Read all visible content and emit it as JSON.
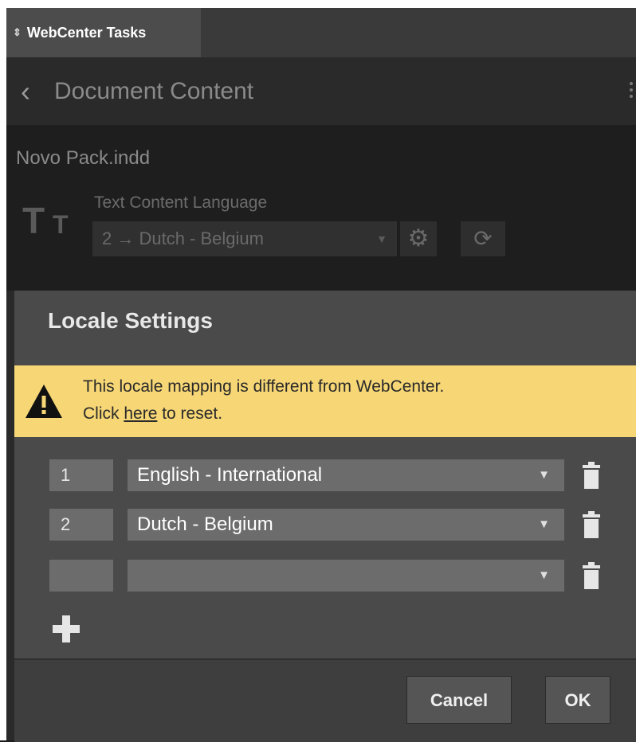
{
  "tab": {
    "label": "WebCenter Tasks",
    "arrow": "⇕"
  },
  "header": {
    "back": "‹",
    "title": "Document Content"
  },
  "document": {
    "filename": "Novo Pack.indd",
    "language_label": "Text Content Language",
    "language_value": "2 → Dutch - Belgium"
  },
  "dialog": {
    "title": "Locale Settings",
    "warning": {
      "line1": "This locale mapping is different from WebCenter.",
      "line2_prefix": "Click ",
      "link": "here",
      "line2_suffix": " to reset."
    },
    "rows": [
      {
        "number": "1",
        "locale": "English - International"
      },
      {
        "number": "2",
        "locale": "Dutch - Belgium"
      },
      {
        "number": "",
        "locale": ""
      }
    ],
    "cancel_label": "Cancel",
    "ok_label": "OK"
  },
  "colors": {
    "warning": "#f6d675",
    "dialog": "#4a4a4a",
    "field": "#6c6c6c"
  },
  "icons": [
    "back-chevron-icon",
    "text-type-icon",
    "gear-icon",
    "sync-icon",
    "warning-icon",
    "trash-icon",
    "plus-icon"
  ]
}
